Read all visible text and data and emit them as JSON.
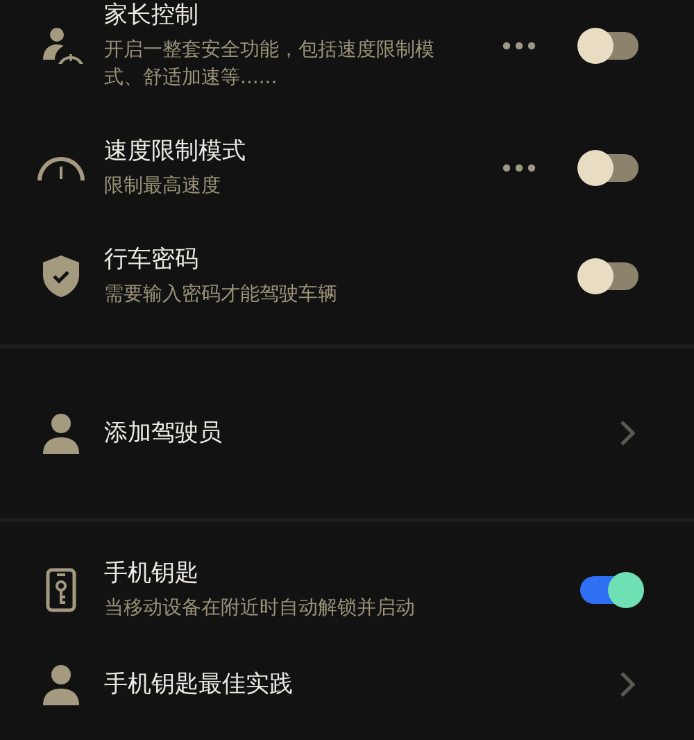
{
  "sections": [
    {
      "items": [
        {
          "kind": "toggle",
          "title": "家长控制",
          "description": "开启一整套安全功能，包括速度限制模式、舒适加速等......",
          "more": true,
          "on": false
        },
        {
          "kind": "toggle",
          "title": "速度限制模式",
          "description": "限制最高速度",
          "more": true,
          "on": false
        },
        {
          "kind": "toggle",
          "title": "行车密码",
          "description": "需要输入密码才能驾驶车辆",
          "more": false,
          "on": false
        }
      ]
    },
    {
      "items": [
        {
          "kind": "link",
          "title": "添加驾驶员"
        }
      ]
    },
    {
      "items": [
        {
          "kind": "toggle",
          "title": "手机钥匙",
          "description": "当移动设备在附近时自动解锁并启动",
          "more": false,
          "on": true
        },
        {
          "kind": "link",
          "title": "手机钥匙最佳实践"
        }
      ]
    }
  ]
}
